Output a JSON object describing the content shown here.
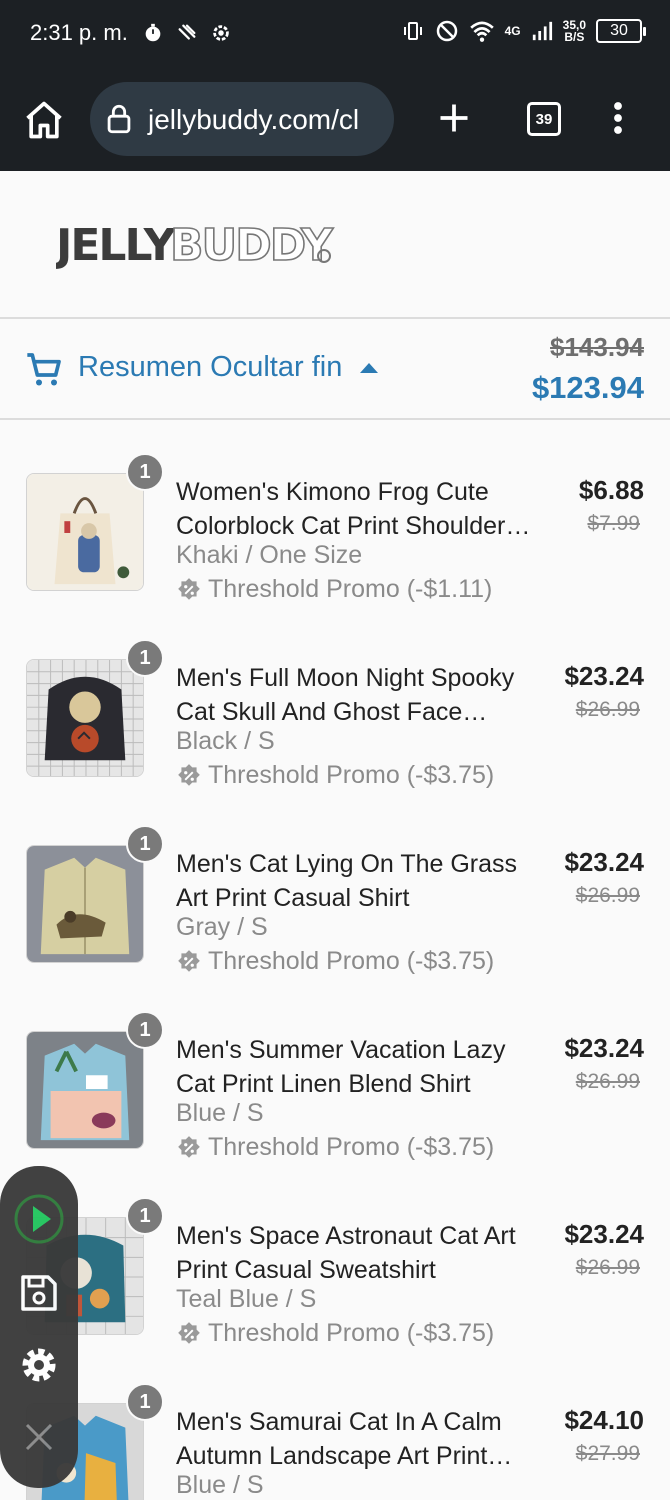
{
  "status_bar": {
    "time": "2:31 p. m.",
    "net_speed_top": "35,0",
    "net_speed_bottom": "B/S",
    "network": "4G",
    "battery": "30"
  },
  "browser": {
    "url": "jellybuddy.com/cl",
    "tab_count": "39"
  },
  "logo": {
    "part1": "JELLY",
    "part2": "BUDDY"
  },
  "summary": {
    "toggle_label": "Resumen Ocultar fin",
    "original_total": "$143.94",
    "total": "$123.94"
  },
  "items": [
    {
      "qty": "1",
      "title": "Women's Kimono Frog Cute Colorblock Cat Print Shoulder…",
      "variant": "Khaki / One Size",
      "promo": "Threshold Promo (-$1.11)",
      "price": "$6.88",
      "compare": "$7.99"
    },
    {
      "qty": "1",
      "title": "Men's Full Moon Night Spooky Cat Skull And Ghost Face…",
      "variant": "Black / S",
      "promo": "Threshold Promo (-$3.75)",
      "price": "$23.24",
      "compare": "$26.99"
    },
    {
      "qty": "1",
      "title": "Men's Cat Lying On The Grass Art Print Casual Shirt",
      "variant": "Gray / S",
      "promo": "Threshold Promo (-$3.75)",
      "price": "$23.24",
      "compare": "$26.99"
    },
    {
      "qty": "1",
      "title": "Men's Summer Vacation Lazy Cat Print Linen Blend Shirt",
      "variant": "Blue / S",
      "promo": "Threshold Promo (-$3.75)",
      "price": "$23.24",
      "compare": "$26.99"
    },
    {
      "qty": "1",
      "title": "Men's Space Astronaut Cat Art Print Casual Sweatshirt",
      "variant": "Teal Blue / S",
      "promo": "Threshold Promo (-$3.75)",
      "price": "$23.24",
      "compare": "$26.99"
    },
    {
      "qty": "1",
      "title": "Men's Samurai Cat In A Calm Autumn Landscape Art Print…",
      "variant": "Blue / S",
      "promo": "",
      "price": "$24.10",
      "compare": "$27.99"
    }
  ],
  "colors": {
    "accent": "#2b7ab3",
    "chrome": "#1c2024",
    "play": "#22c55e"
  },
  "icons": [
    "home-icon",
    "lock-icon",
    "plus-icon",
    "tabs-icon",
    "kebab-menu-icon",
    "cart-icon",
    "caret-up-icon",
    "promo-tag-icon",
    "play-icon",
    "save-icon",
    "gear-icon",
    "close-icon"
  ]
}
